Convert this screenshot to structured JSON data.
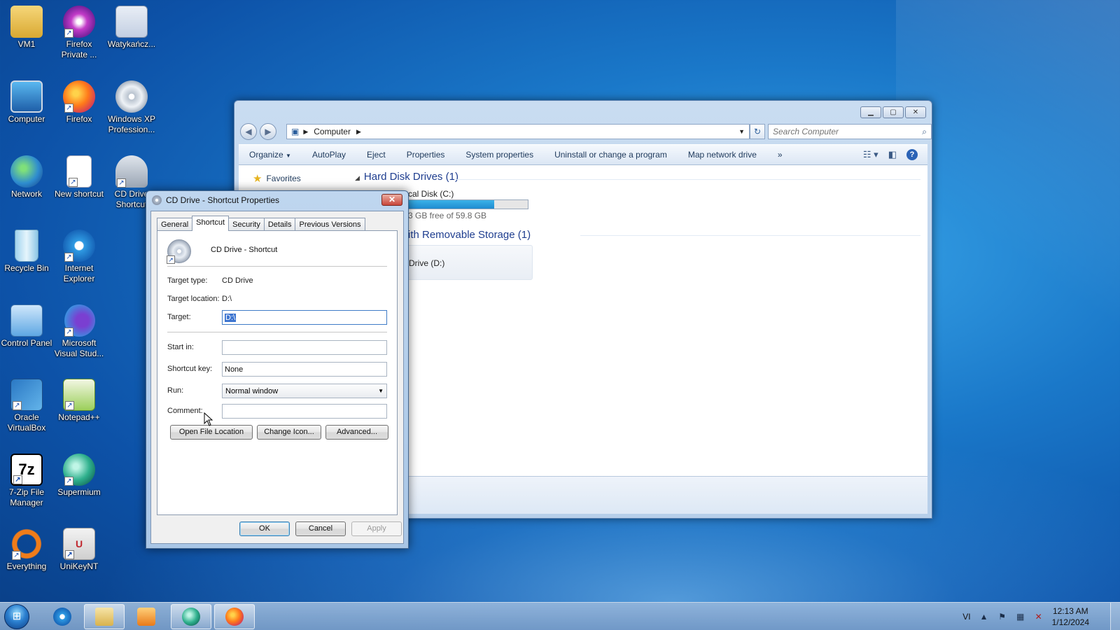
{
  "desktop": {
    "icons": [
      {
        "label": "VM1",
        "icon": "folder-user-icon"
      },
      {
        "label": "Firefox Private ...",
        "icon": "firefox-private-icon"
      },
      {
        "label": "Watykańcz...",
        "icon": "window-image-icon"
      },
      {
        "label": "Computer",
        "icon": "computer-icon"
      },
      {
        "label": "Firefox",
        "icon": "firefox-icon"
      },
      {
        "label": "Windows XP Profession...",
        "icon": "disc-icon"
      },
      {
        "label": "Network",
        "icon": "network-icon"
      },
      {
        "label": "New shortcut",
        "icon": "blank-document-icon"
      },
      {
        "label": "CD Drive Shortcut",
        "icon": "cd-drive-icon"
      },
      {
        "label": "Recycle Bin",
        "icon": "recycle-bin-icon"
      },
      {
        "label": "Internet Explorer",
        "icon": "internet-explorer-icon"
      },
      {
        "label": "Control Panel",
        "icon": "control-panel-icon"
      },
      {
        "label": "Microsoft Visual Stud...",
        "icon": "visual-studio-icon"
      },
      {
        "label": "Oracle VirtualBox",
        "icon": "virtualbox-icon"
      },
      {
        "label": "Notepad++",
        "icon": "notepad-plus-plus-icon"
      },
      {
        "label": "7-Zip File Manager",
        "icon": "seven-zip-icon"
      },
      {
        "label": "Supermium",
        "icon": "supermium-icon"
      },
      {
        "label": "Everything",
        "icon": "everything-search-icon"
      },
      {
        "label": "UniKeyNT",
        "icon": "unikey-icon"
      }
    ]
  },
  "explorer": {
    "breadcrumb": "Computer",
    "search_placeholder": "Search Computer",
    "toolbar": [
      "Organize",
      "AutoPlay",
      "Eject",
      "Properties",
      "System properties",
      "Uninstall or change a program",
      "Map network drive"
    ],
    "more": "»",
    "favorites": "Favorites",
    "hard_disk_group": "Hard Disk Drives (1)",
    "local_disk_label": "cal Disk (C:)",
    "local_disk_free": "3 GB free of 59.8 GB",
    "local_disk_used_fraction": 0.72,
    "removable_group": "ith Removable Storage (1)",
    "cd_drive_label": "Drive (D:)"
  },
  "dialog": {
    "title": "CD Drive - Shortcut Properties",
    "tabs": [
      "General",
      "Shortcut",
      "Security",
      "Details",
      "Previous Versions"
    ],
    "active_tab": "Shortcut",
    "shortcut_name": "CD Drive - Shortcut",
    "target_type_label": "Target type:",
    "target_type_value": "CD Drive",
    "target_location_label": "Target location:",
    "target_location_value": "D:\\",
    "target_label": "Target:",
    "target_value": "D:\\",
    "start_in_label": "Start in:",
    "start_in_value": "",
    "shortcut_key_label": "Shortcut key:",
    "shortcut_key_value": "None",
    "run_label": "Run:",
    "run_value": "Normal window",
    "comment_label": "Comment:",
    "comment_value": "",
    "open_file_location": "Open File Location",
    "change_icon": "Change Icon...",
    "advanced": "Advanced...",
    "ok": "OK",
    "cancel": "Cancel",
    "apply": "Apply"
  },
  "taskbar": {
    "language": "VI",
    "time": "12:13 AM",
    "date": "1/12/2024"
  }
}
